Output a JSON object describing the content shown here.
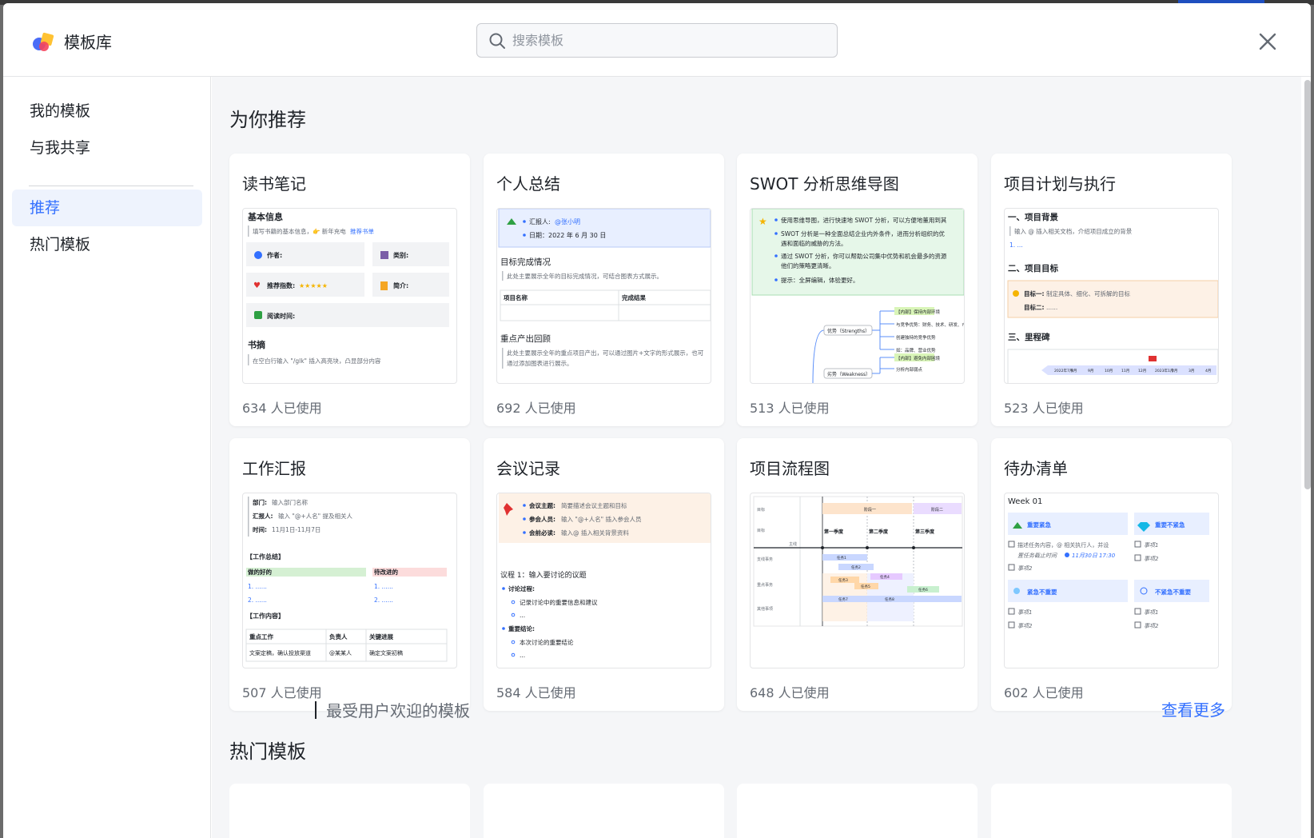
{
  "header": {
    "title": "模板库",
    "search_placeholder": "搜索模板"
  },
  "sidebar": {
    "items": [
      {
        "label": "我的模板"
      },
      {
        "label": "与我共享"
      },
      {
        "label": "推荐"
      },
      {
        "label": "热门模板"
      }
    ]
  },
  "recommended": {
    "title": "为你推荐",
    "cards": [
      {
        "title": "读书笔记",
        "usage": "634 人已使用"
      },
      {
        "title": "个人总结",
        "usage": "692 人已使用"
      },
      {
        "title": "SWOT 分析思维导图",
        "usage": "513 人已使用"
      },
      {
        "title": "项目计划与执行",
        "usage": "523 人已使用"
      },
      {
        "title": "工作汇报",
        "usage": "507 人已使用"
      },
      {
        "title": "会议记录",
        "usage": "584 人已使用"
      },
      {
        "title": "项目流程图",
        "usage": "648 人已使用"
      },
      {
        "title": "待办清单",
        "usage": "602 人已使用"
      }
    ]
  },
  "popular": {
    "title": "热门模板",
    "subtitle": "最受用户欢迎的模板",
    "see_more": "查看更多"
  },
  "previews": {
    "reading": {
      "h_basic": "基本信息",
      "hint": "填写书籍的基本信息，👉 新年充电",
      "hint_link": "推荐书单",
      "author": "作者:",
      "category": "类别:",
      "rating": "推荐指数:",
      "stars": "★★★★★",
      "intro": "简介:",
      "time": "阅读时间:",
      "h_excerpt": "书摘",
      "excerpt_hint": "在空白行输入 \"/glk\" 插入高亮块，凸显部分内容"
    },
    "summary": {
      "reporter_label": "汇报人:",
      "reporter": "@张小明",
      "date": "日期：2022 年 6 月 30 日",
      "h_goals": "目标完成情况",
      "goals_hint": "此处主要展示全年的目标完成情况，可结合图表方式展示。",
      "col_name": "项目名称",
      "col_result": "完成结果",
      "h_review": "重点产出回顾",
      "review_hint": "此处主要展示全年的重点项目产出，可以通过图片+文字的形式展示，也可",
      "review_hint2": "通过添加图表进行展示。"
    },
    "swot": {
      "b1": "使用思维导图，进行快速地 SWOT 分析，可以方便地董用到其",
      "b2": "SWOT 分析是一种全面总结企业内外条件，进而分析组织的优",
      "b2b": "遇和面临的威胁的方法。",
      "b3": "通过 SWOT 分析，你可以帮助公司集中优势和机会最多的资源",
      "b3b": "他们的策略更清晰。",
      "b4": "提示：全屏编辑，体验更好。",
      "node_s": "优势（Strengths）",
      "node_w": "劣势（Weakness）",
      "leaf1": "【内部】保持内部环境",
      "leaf2": "与竞争优势：财务、技术、研发、市",
      "leaf3": "创建独特的竞争优势",
      "leaf4": "如：品牌、营业优势",
      "leaf5": "【内部】避免内部困境",
      "leaf6": "分析内部弱点"
    },
    "plan": {
      "h1": "一、项目背景",
      "h1_hint": "输入 @ 插入相关文档，介绍项目成立的背景",
      "h1_item": "1. ...",
      "h2": "二、项目目标",
      "goal1_label": "目标一:",
      "goal1": "制定具体、细化、可拆解的目标",
      "goal2_label": "目标二:",
      "goal2": "......",
      "h3": "三、里程碑",
      "timeline": [
        "2022年7月",
        "8月",
        "9月",
        "10月",
        "11月",
        "12月",
        "2023年1月",
        "2月",
        "3月",
        "4月"
      ]
    },
    "report": {
      "dept_label": "部门:",
      "dept": "输入部门名称",
      "reporter_label": "汇报人:",
      "reporter": "输入 \"@+人名\" 提及相关人",
      "time_label": "时间:",
      "time": "11月1日-11月7日",
      "h_summary": "【工作总结】",
      "good": "做的好的",
      "improve": "待改进的",
      "item1": "1. ......",
      "item2": "2. ......",
      "h_content": "【工作内容】",
      "col1": "重点工作",
      "col2": "负责人",
      "col3": "关键进展",
      "r1c1": "文案定稿，确认投放渠道",
      "r1c2": "@某某人",
      "r1c3": "确定文案初稿"
    },
    "meeting": {
      "topic_label": "会议主题:",
      "topic": "简要描述会议主题和目标",
      "attendees_label": "参会人员:",
      "attendees": "输入 \"@+人名\" 插入参会人员",
      "reading_label": "会前必读:",
      "reading": "输入@ 插入相关背景资料",
      "agenda": "议程 1：输入要讨论的议题",
      "discussion": "讨论过程:",
      "disc1": "记录讨论中的重要信息和建议",
      "disc2": "...",
      "conclusion": "重要结论:",
      "conc1": "本次讨论的重要结论",
      "conc2": "..."
    },
    "flow": {
      "rows": [
        "目标",
        "目标",
        "主线",
        "支线事务",
        "重点事务",
        "其他事项"
      ],
      "phases": [
        "第一季度",
        "第二季度",
        "第三季度"
      ],
      "blocks": [
        "阶段一",
        "阶段二",
        "任务1",
        "任务2",
        "任务3",
        "任务4",
        "任务5",
        "任务6",
        "任务7",
        "任务8"
      ]
    },
    "todo": {
      "week": "Week 01",
      "q1": "重要紧急",
      "q2": "重要不紧急",
      "q3": "紧急不重要",
      "q4": "不紧急不重要",
      "task_desc": "描述任务内容，@ 相关执行人，并设",
      "task_desc2": "置任务截止时间",
      "deadline": "11月30日 17:30",
      "item1": "事项1",
      "item2": "事项2"
    }
  },
  "colors": {
    "accent": "#3370ff",
    "active_bg": "#eef3fd",
    "content_bg": "#f5f6f8"
  }
}
